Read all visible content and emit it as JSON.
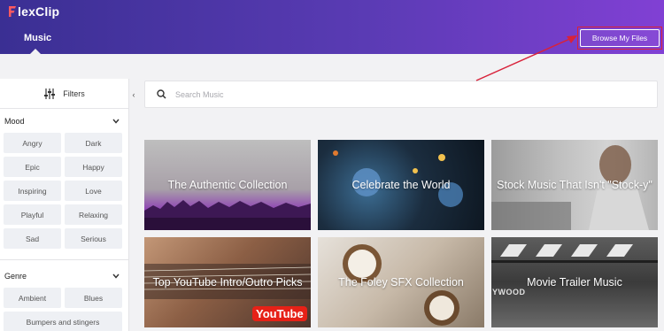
{
  "header": {
    "logo_text": "lexClip",
    "tab_label": "Music",
    "browse_button_label": "Browse My Files"
  },
  "sidebar": {
    "filters_label": "Filters",
    "sections": [
      {
        "title": "Mood",
        "tags": [
          "Angry",
          "Dark",
          "Epic",
          "Happy",
          "Inspiring",
          "Love",
          "Playful",
          "Relaxing",
          "Sad",
          "Serious"
        ]
      },
      {
        "title": "Genre",
        "tags": [
          "Ambient",
          "Blues"
        ],
        "wide_tags": [
          "Bumpers and stingers"
        ]
      }
    ]
  },
  "collapse_glyph": "‹",
  "search": {
    "placeholder": "Search Music"
  },
  "collections": [
    {
      "title": "The Authentic Collection"
    },
    {
      "title": "Celebrate the World"
    },
    {
      "title": "Stock Music That Isn't \"Stock-y\""
    },
    {
      "title": "Top YouTube Intro/Outro Picks"
    },
    {
      "title": "The Foley SFX Collection"
    },
    {
      "title": "Movie Trailer Music"
    }
  ],
  "card_overlays": {
    "youtube_logo": "YouTube",
    "clapper_text": "YWOOD"
  },
  "colors": {
    "header_start": "#3a2f93",
    "header_end": "#8140d4",
    "annotation_red": "#d8223a",
    "youtube_red": "#e62117"
  },
  "icons": {
    "logo": "flexclip-f-logo",
    "filters": "sliders-icon",
    "section_toggle": "chevron-down-icon",
    "search": "search-icon"
  }
}
